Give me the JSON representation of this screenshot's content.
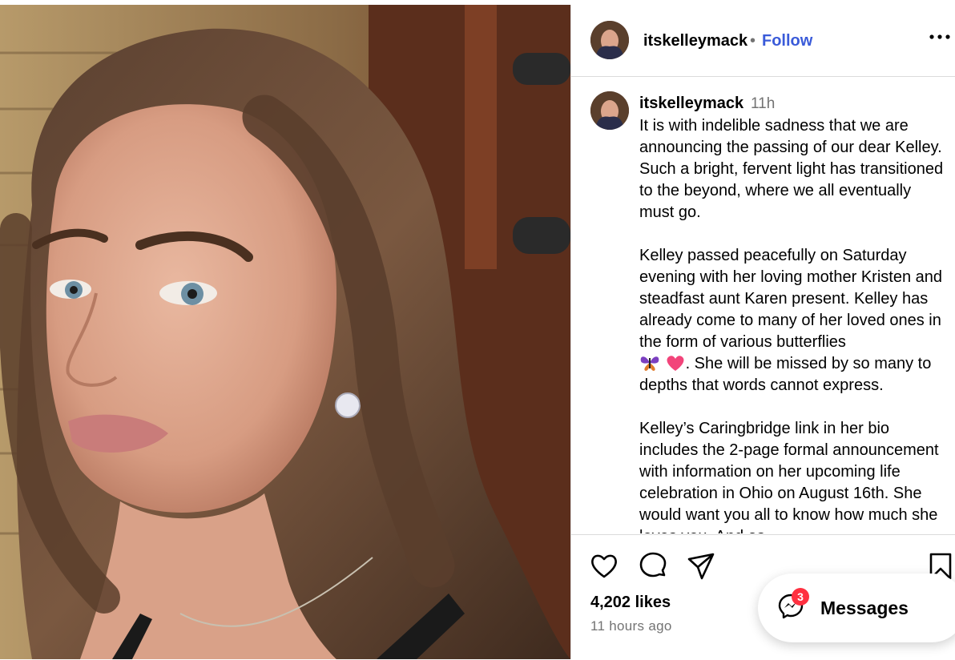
{
  "post": {
    "username": "itskelleymack",
    "follow_label": "Follow",
    "separator": "•",
    "more_icon": "more-horizontal-icon"
  },
  "caption": {
    "username": "itskelleymack",
    "time": "11h",
    "paragraph1": "It is with indelible sadness that we are announcing the passing of our dear Kelley. Such a bright, fervent light has transitioned to the beyond, where we all eventually must go.",
    "paragraph2_before_emoji": "Kelley passed peacefully on Saturday evening with her loving mother Kristen and steadfast aunt Karen present. Kelley has already come to many of her loved ones in the form of various butterflies",
    "emoji": [
      "butterfly-emoji",
      "pink-heart-emoji"
    ],
    "paragraph2_after_emoji": ". She will be missed by so many to depths that words cannot express.",
    "paragraph3": "Kelley’s Caringbridge link in her bio includes the 2-page formal announcement with information on her upcoming life celebration in Ohio on August 16th. She would want you all to know how much she loves you. And as"
  },
  "actions": {
    "icons": [
      "heart-icon",
      "comment-icon",
      "share-icon",
      "bookmark-icon"
    ],
    "likes": "4,202 likes",
    "time_ago": "11 hours ago"
  },
  "messages": {
    "label": "Messages",
    "badge_count": "3",
    "badge_color": "#ff3040"
  },
  "colors": {
    "follow": "#3a5bd9",
    "muted": "#737373",
    "border": "#dbdbdb"
  }
}
